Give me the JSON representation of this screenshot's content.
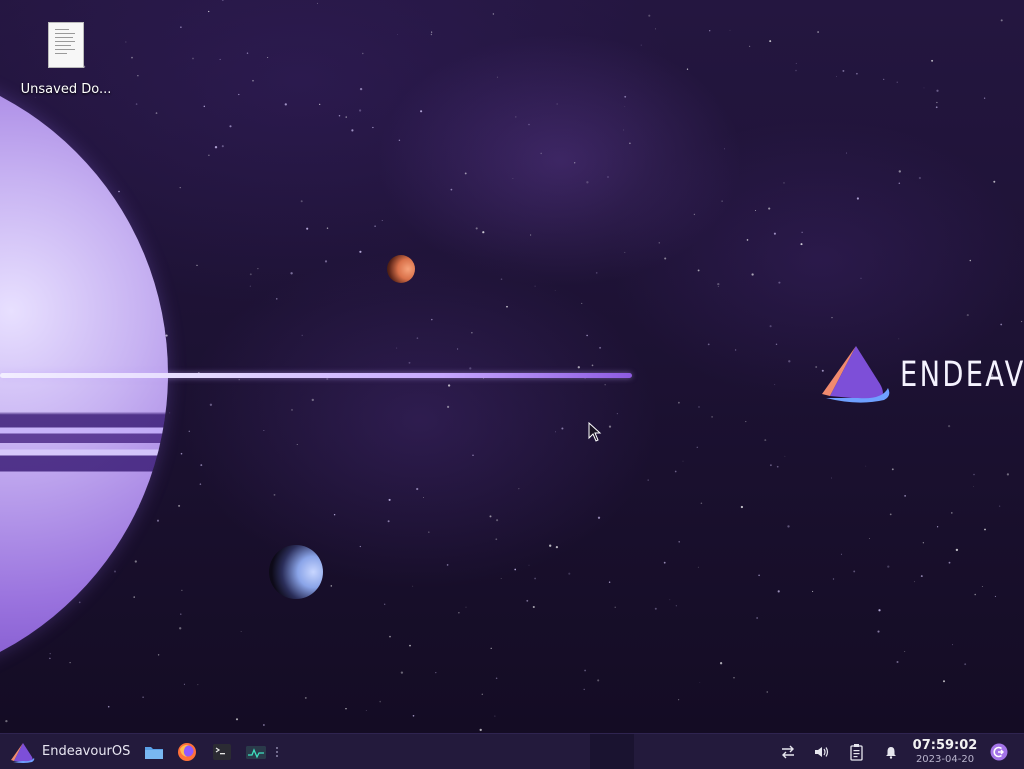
{
  "desktop": {
    "icons": [
      {
        "label": "Unsaved Do...",
        "icon": "document-icon"
      }
    ],
    "wallpaper": {
      "brand_text": "ENDEAVOU",
      "colors": {
        "planet": "#9a73de",
        "ring": "#e6dcff",
        "sky": "#1d1234"
      }
    }
  },
  "taskbar": {
    "start_label": "EndeavourOS",
    "launchers": [
      {
        "name": "file-manager",
        "icon": "folder-icon"
      },
      {
        "name": "firefox",
        "icon": "firefox-icon"
      },
      {
        "name": "terminal",
        "icon": "terminal-icon"
      },
      {
        "name": "system-monitor",
        "icon": "system-monitor-icon"
      }
    ],
    "tray": [
      {
        "name": "network",
        "icon": "network-arrows-icon"
      },
      {
        "name": "volume",
        "icon": "speaker-icon"
      },
      {
        "name": "clipboard",
        "icon": "clipboard-icon"
      },
      {
        "name": "notifications",
        "icon": "bell-icon"
      }
    ],
    "clock": {
      "time": "07:59:02",
      "date": "2023-04-20"
    },
    "colors": {
      "background": "#231a3c",
      "accent": "#a374e8"
    }
  }
}
